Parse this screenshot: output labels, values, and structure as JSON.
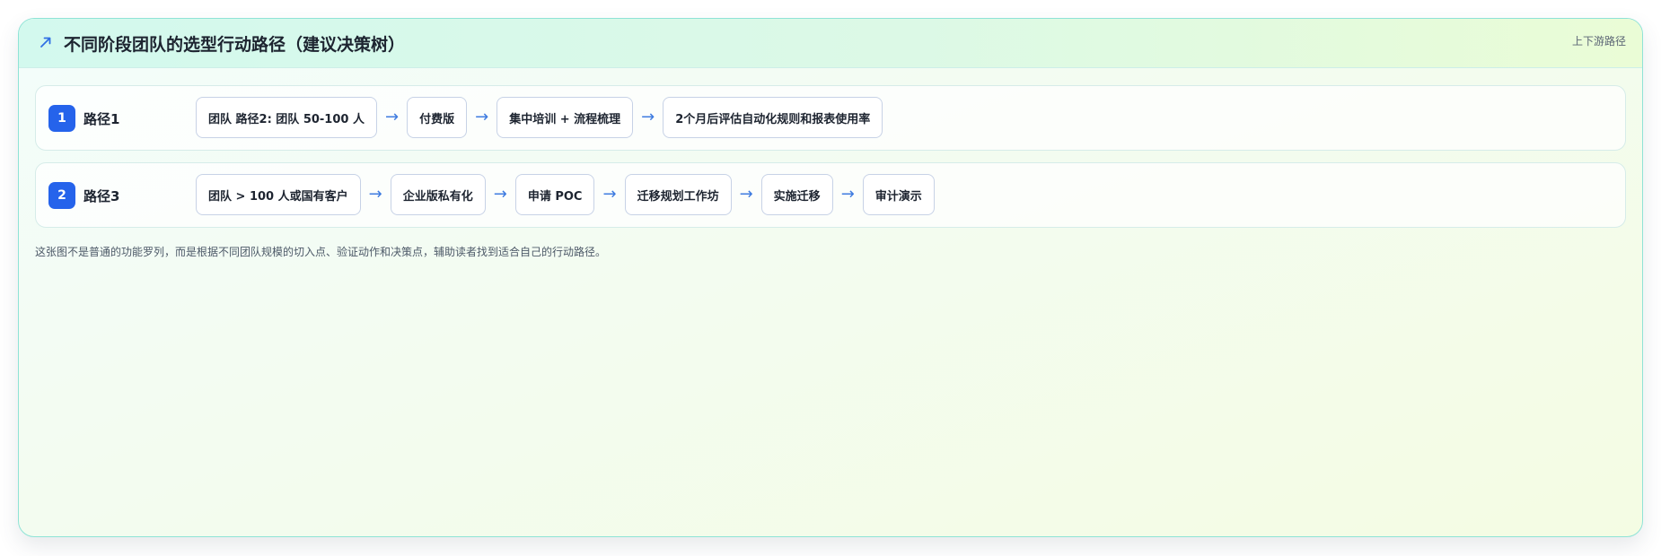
{
  "header": {
    "icon": "trend-arrow-icon",
    "title": "不同阶段团队的选型行动路径（建议决策树）",
    "link": "上下游路径"
  },
  "paths": [
    {
      "number": "1",
      "name": "路径1",
      "steps": [
        "团队 路径2: 团队 50-100 人",
        "付费版",
        "集中培训 + 流程梳理",
        "2个月后评估自动化规则和报表使用率"
      ]
    },
    {
      "number": "2",
      "name": "路径3",
      "steps": [
        "团队 > 100 人或国有客户",
        "企业版私有化",
        "申请 POC",
        "迁移规划工作坊",
        "实施迁移",
        "审计演示"
      ]
    }
  ],
  "arrow_glyph": "→",
  "note": "这张图不是普通的功能罗列，而是根据不同团队规模的切入点、验证动作和决策点，辅助读者找到适合自己的行动路径。",
  "colors": {
    "accent": "#2563eb",
    "arrow": "#3e7be0",
    "border": "#8fe3d6"
  }
}
